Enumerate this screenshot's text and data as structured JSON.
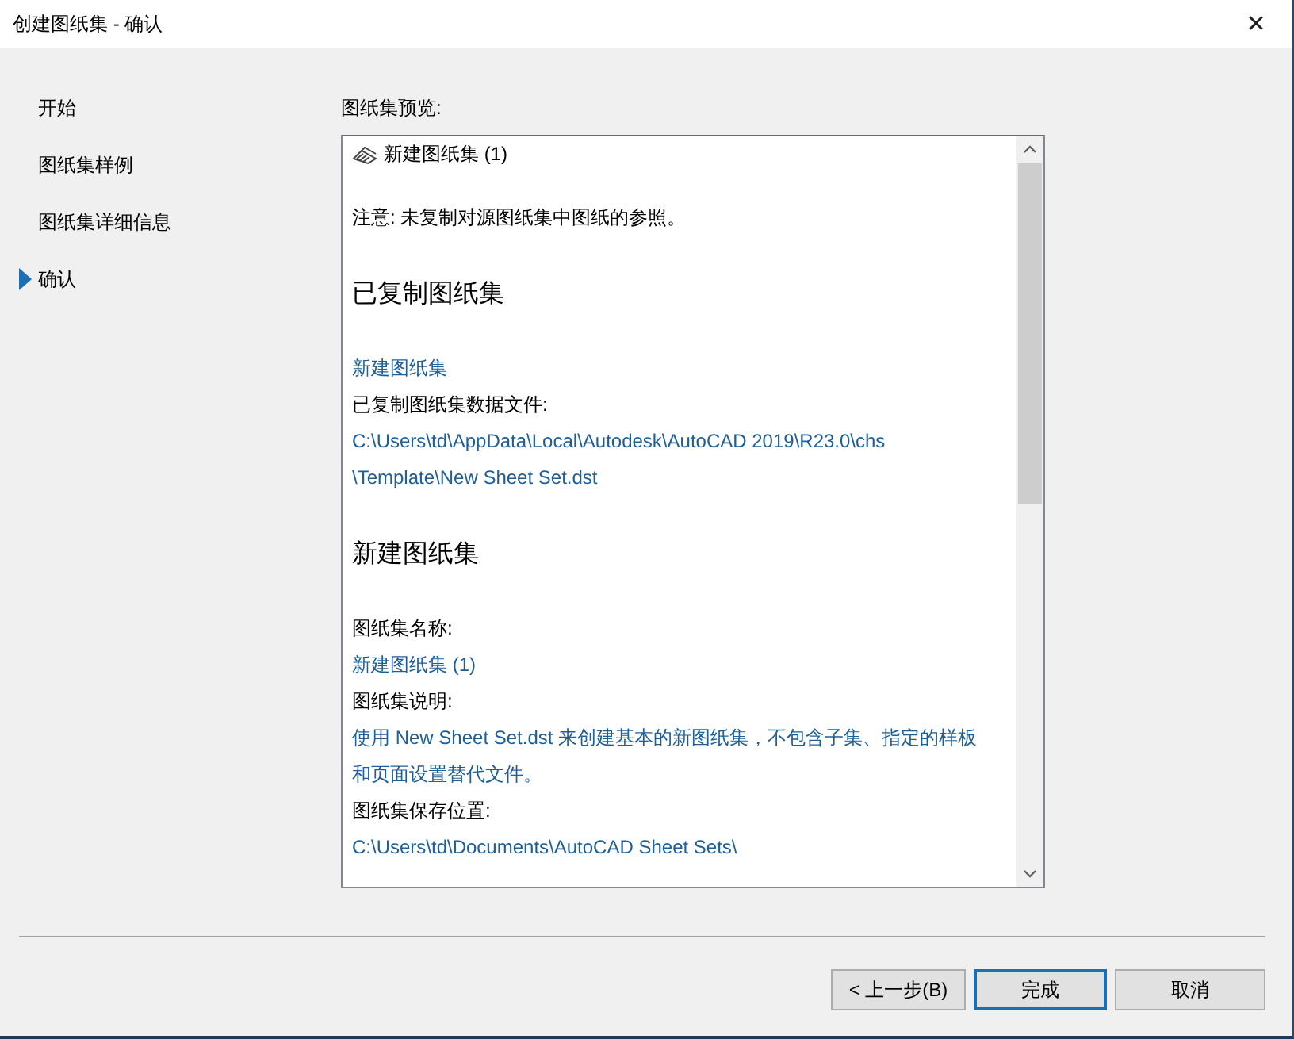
{
  "window": {
    "title": "创建图纸集 - 确认",
    "close": "✕"
  },
  "steps": [
    {
      "label": "开始",
      "selected": false
    },
    {
      "label": "图纸集样例",
      "selected": false
    },
    {
      "label": "图纸集详细信息",
      "selected": false
    },
    {
      "label": "确认",
      "selected": true
    }
  ],
  "preview": {
    "label": "图纸集预览:",
    "lines": [
      {
        "kind": "title",
        "text": "新建图纸集 (1)"
      },
      {
        "kind": "note",
        "text": "注意: 未复制对源图纸集中图纸的参照。"
      },
      {
        "kind": "heading",
        "text": "已复制图纸集"
      },
      {
        "kind": "value",
        "text": "新建图纸集"
      },
      {
        "kind": "label",
        "text": "已复制图纸集数据文件:"
      },
      {
        "kind": "value",
        "text": "C:\\Users\\td\\AppData\\Local\\Autodesk\\AutoCAD 2019\\R23.0\\chs"
      },
      {
        "kind": "value",
        "text": "\\Template\\New Sheet Set.dst"
      },
      {
        "kind": "heading",
        "text": "新建图纸集"
      },
      {
        "kind": "label",
        "text": "图纸集名称:"
      },
      {
        "kind": "value",
        "text": "新建图纸集 (1)"
      },
      {
        "kind": "label",
        "text": "图纸集说明:"
      },
      {
        "kind": "value",
        "text": "使用 New Sheet Set.dst 来创建基本的新图纸集，不包含子集、指定的样板和页面设置替代文件。"
      },
      {
        "kind": "label",
        "text": "图纸集保存位置:"
      },
      {
        "kind": "value",
        "text": "C:\\Users\\td\\Documents\\AutoCAD Sheet Sets\\"
      }
    ]
  },
  "buttons": [
    {
      "label": "< 上一步(B)",
      "kind": "normal"
    },
    {
      "label": "完成",
      "kind": "default"
    },
    {
      "label": "取消",
      "kind": "normal"
    }
  ]
}
